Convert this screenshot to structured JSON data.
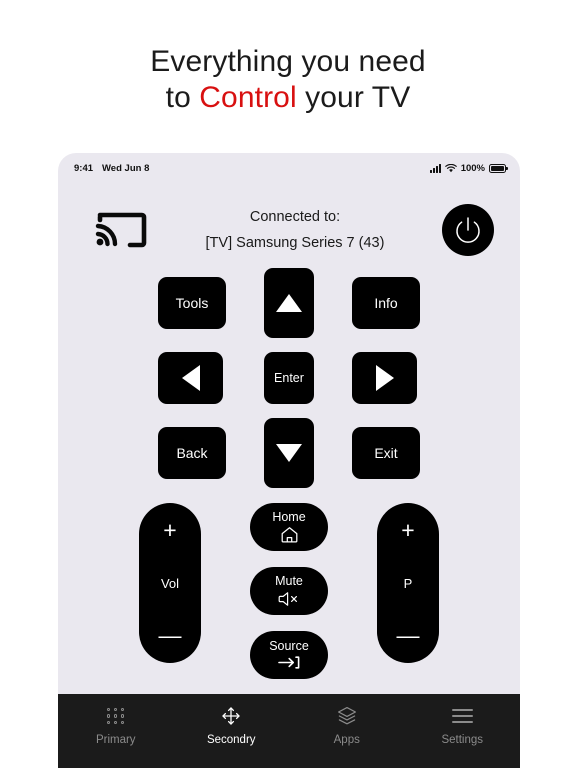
{
  "headline": {
    "line1": "Everything you need",
    "line2_pre": "to ",
    "line2_accent": "Control",
    "line2_post": " your TV",
    "accent_color": "#d81010"
  },
  "statusbar": {
    "time": "9:41",
    "date": "Wed Jun 8",
    "battery_percent": "100%",
    "signal_icon": "cellular-signal-icon",
    "wifi_icon": "wifi-icon",
    "battery_icon": "battery-icon"
  },
  "connection": {
    "cast_icon": "cast-icon",
    "label": "Connected to:",
    "device_name": "[TV] Samsung Series 7 (43)",
    "power_icon": "power-icon"
  },
  "dpad": {
    "tools": "Tools",
    "up": "up-arrow-icon",
    "info": "Info",
    "left": "left-arrow-icon",
    "enter": "Enter",
    "right": "right-arrow-icon",
    "back": "Back",
    "down": "down-arrow-icon",
    "exit": "Exit"
  },
  "lower": {
    "volume": {
      "plus": "+",
      "label": "Vol",
      "minus": "—"
    },
    "program": {
      "plus": "+",
      "label": "P",
      "minus": "—"
    },
    "middle": [
      {
        "label": "Home",
        "icon": "home-icon"
      },
      {
        "label": "Mute",
        "icon": "mute-icon"
      },
      {
        "label": "Source",
        "icon": "source-input-icon"
      }
    ]
  },
  "tabbar": {
    "items": [
      {
        "label": "Primary",
        "icon": "grid-dots-icon",
        "active": false
      },
      {
        "label": "Secondry",
        "icon": "move-arrows-icon",
        "active": true
      },
      {
        "label": "Apps",
        "icon": "layers-icon",
        "active": false
      },
      {
        "label": "Settings",
        "icon": "hamburger-menu-icon",
        "active": false
      }
    ]
  },
  "colors": {
    "screen_bg": "#eae8ef",
    "button_black": "#000000",
    "tabbar_bg": "#1b1b1b",
    "tab_inactive": "#8b8b8b"
  }
}
